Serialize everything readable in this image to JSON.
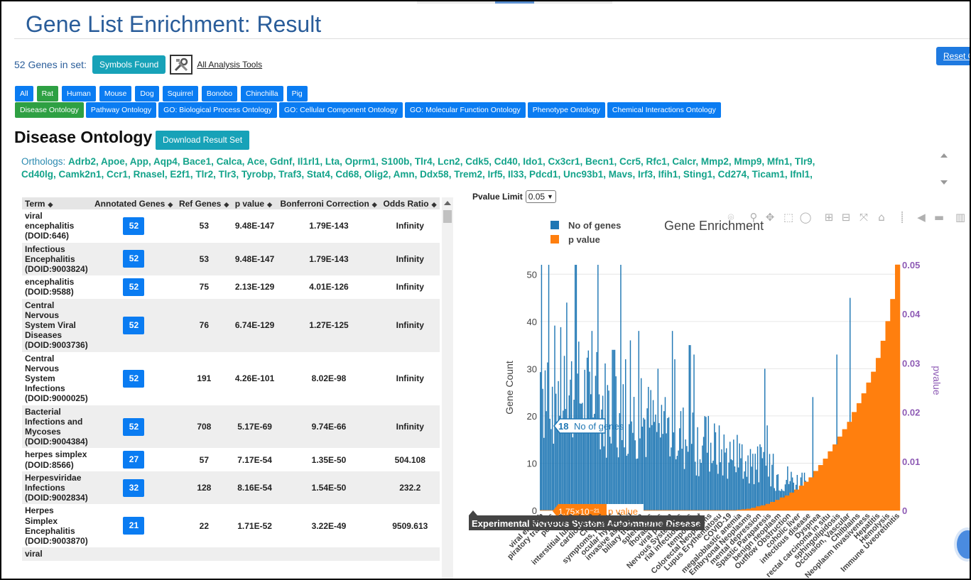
{
  "header": {
    "title": "Gene List Enrichment: Result",
    "reset_label": "Reset C"
  },
  "genes_in_set": {
    "text": "52 Genes in set:",
    "symbols_button": "Symbols Found",
    "tools_link": "All Analysis Tools",
    "tools_icon": "wrench-screwdriver-icon"
  },
  "species": [
    "All",
    "Rat",
    "Human",
    "Mouse",
    "Dog",
    "Squirrel",
    "Bonobo",
    "Chinchilla",
    "Pig"
  ],
  "active_species": "Rat",
  "ontologies": [
    "Disease Ontology",
    "Pathway Ontology",
    "GO: Biological Process Ontology",
    "GO: Cellular Component Ontology",
    "GO: Molecular Function Ontology",
    "Phenotype Ontology",
    "Chemical Interactions Ontology"
  ],
  "active_ontology": "Disease Ontology",
  "section": {
    "title": "Disease Ontology",
    "download_label": "Download Result Set"
  },
  "orthologs": {
    "label": "Orthologs:",
    "line1": "Adrb2,  Apoe,  App,  Aqp4,  Bace1,  Calca,  Ace,  Gdnf,  Il1rl1,  Lta,  Oprm1,  S100b,  Tlr4,  Lcn2,  Cdk5,  Cd40,  Ido1,  Cx3cr1,  Becn1,  Ccr5,  Rfc1,  Calcr,  Mmp2,  Mmp9,  Mfn1,  Tlr9,",
    "line2": "Cd40lg,  Camk2n1,  Ccr1,  Rnasel,  E2f1,  Tlr2,  Tlr3,  Tyrobp,  Traf3,  Stat4,  Cd68,  Olig2,  Amn,  Ddx58,  Trem2,  Irf5,  Il33,  Pdcd1,  Unc93b1,  Mavs,  Irf3,  Ifih1,  Sting1,  Cd274,  Ticam1,  Ifnl1,"
  },
  "table": {
    "columns": [
      "Term",
      "Annotated Genes",
      "Ref Genes",
      "p value",
      "Bonferroni Correction",
      "Odds Ratio"
    ],
    "rows": [
      {
        "term": "viral encephalitis (DOID:646)",
        "annotated": "52",
        "ref": "53",
        "p": "9.48E-147",
        "bonf": "1.79E-143",
        "odds": "Infinity"
      },
      {
        "term": "Infectious Encephalitis (DOID:9003824)",
        "annotated": "52",
        "ref": "53",
        "p": "9.48E-147",
        "bonf": "1.79E-143",
        "odds": "Infinity"
      },
      {
        "term": "encephalitis (DOID:9588)",
        "annotated": "52",
        "ref": "75",
        "p": "2.13E-129",
        "bonf": "4.01E-126",
        "odds": "Infinity"
      },
      {
        "term": "Central Nervous System Viral Diseases (DOID:9003736)",
        "annotated": "52",
        "ref": "76",
        "p": "6.74E-129",
        "bonf": "1.27E-125",
        "odds": "Infinity"
      },
      {
        "term": "Central Nervous System Infections (DOID:9000025)",
        "annotated": "52",
        "ref": "191",
        "p": "4.26E-101",
        "bonf": "8.02E-98",
        "odds": "Infinity"
      },
      {
        "term": "Bacterial Infections and Mycoses (DOID:9004384)",
        "annotated": "52",
        "ref": "708",
        "p": "5.17E-69",
        "bonf": "9.74E-66",
        "odds": "Infinity"
      },
      {
        "term": "herpes simplex (DOID:8566)",
        "annotated": "27",
        "ref": "57",
        "p": "7.17E-54",
        "bonf": "1.35E-50",
        "odds": "504.108"
      },
      {
        "term": "Herpesviridae Infections (DOID:9002834)",
        "annotated": "32",
        "ref": "128",
        "p": "8.16E-54",
        "bonf": "1.54E-50",
        "odds": "232.2"
      },
      {
        "term": "Herpes Simplex Encephalitis (DOID:9003870)",
        "annotated": "21",
        "ref": "22",
        "p": "1.71E-52",
        "bonf": "3.22E-49",
        "odds": "9509.613"
      },
      {
        "term": "viral",
        "annotated": "",
        "ref": "",
        "p": "",
        "bonf": "",
        "odds": ""
      }
    ]
  },
  "pvalue_limit": {
    "label": "Pvalue Limit",
    "value": "0.05"
  },
  "chart_data": {
    "type": "bar",
    "title": "Gene Enrichment",
    "ylabel": "Gene Count",
    "y2label": "pvalue",
    "ylim": [
      0,
      52
    ],
    "y2lim": [
      0,
      0.05
    ],
    "yticks": [
      "0",
      "10",
      "20",
      "30",
      "40",
      "50"
    ],
    "y2ticks": [
      "0",
      "0.01",
      "0.02",
      "0.03",
      "0.04",
      "0.05"
    ],
    "legend": {
      "position": "top-left",
      "entries": [
        {
          "name": "No of genes",
          "color": "#1f77b4"
        },
        {
          "name": "p value",
          "color": "#ff7f0e"
        }
      ]
    },
    "series": [
      {
        "name": "No of genes",
        "color": "#1f77b4",
        "peaks": [
          52,
          52,
          50,
          47,
          52,
          44,
          46,
          52,
          52,
          42,
          38,
          52,
          52,
          35,
          38,
          34,
          52,
          32,
          36,
          30,
          38,
          28,
          35,
          40,
          30,
          27,
          24,
          38,
          32,
          30,
          28,
          35,
          33,
          26,
          24,
          20,
          22,
          18,
          25,
          17,
          15,
          16,
          14,
          13,
          12,
          14,
          30,
          18,
          12,
          10,
          9,
          11,
          26,
          13,
          8,
          7,
          24,
          10,
          6,
          5,
          9,
          33,
          4,
          3,
          45,
          3,
          2,
          3,
          2,
          2,
          2,
          2,
          2,
          2,
          2
        ]
      },
      {
        "name": "p value",
        "color": "#ff7f0e",
        "values": [
          0,
          0,
          0,
          0,
          0,
          0,
          0,
          0,
          0,
          0,
          0,
          0,
          0,
          0,
          0,
          0,
          0,
          0,
          0,
          0,
          0,
          0,
          0,
          0,
          0,
          0,
          0,
          0,
          0,
          0,
          0,
          0,
          0,
          0,
          0,
          0,
          0,
          0,
          0,
          0,
          0,
          0.0001,
          0.0002,
          0.0003,
          0.0005,
          0.0008,
          0.001,
          0.0013,
          0.0017,
          0.0021,
          0.0026,
          0.003,
          0.0036,
          0.0042,
          0.005,
          0.0058,
          0.0067,
          0.008,
          0.0092,
          0.0105,
          0.012,
          0.0134,
          0.015,
          0.0165,
          0.018,
          0.02,
          0.0218,
          0.0238,
          0.026,
          0.0282,
          0.031,
          0.0345,
          0.0385,
          0.043,
          0.05
        ]
      }
    ],
    "hover": [
      {
        "label": "18",
        "series": "No of genes"
      },
      {
        "label": "1.75×10⁻²¹",
        "series": "p value"
      }
    ],
    "hover_tooltip": "Experimental Nervous System Autoimmune Disease",
    "x_tick_labels": [
      "viral enceph",
      "piratory tract dis",
      "periodo",
      "tauo",
      "interstitial lung dis",
      "cardiomyop",
      "Chronic",
      "symptoms, Respir",
      "ocular hypertel",
      "invasive aspergil",
      "biliary tract ca",
      "splenic dis",
      "thoracic dis",
      "viral pneum",
      "Nervous System dis",
      "rial infectious dis",
      "temporal art",
      "Colorectal Neoplasms",
      "Lupus Erythematosu",
      "COVID-19",
      "megaloblastic anemia",
      "Embryonal Neoplasms",
      "mental depression",
      "Spastic Paraparesis",
      "benign neoplasm",
      "Outflow Obstruction",
      "coholic liver",
      "infectious disease",
      "Dyspnea",
      "rectal carcinoma in situ",
      "sphingolipidosis",
      "Occlusion, Vascular",
      "Chilblains",
      "Neoplasm Invasiveness",
      "Hepatitis",
      "Hemolysis",
      "Immune Uveoretinitis"
    ]
  },
  "modebar": [
    "camera-icon",
    "zoom-icon",
    "pan-icon",
    "box-select-icon",
    "lasso-icon",
    "zoom-in-icon",
    "zoom-out-icon",
    "autoscale-icon",
    "home-icon",
    "spike-lines-icon",
    "hover-closest-icon",
    "hover-compare-icon",
    "plotly-logo-icon"
  ]
}
